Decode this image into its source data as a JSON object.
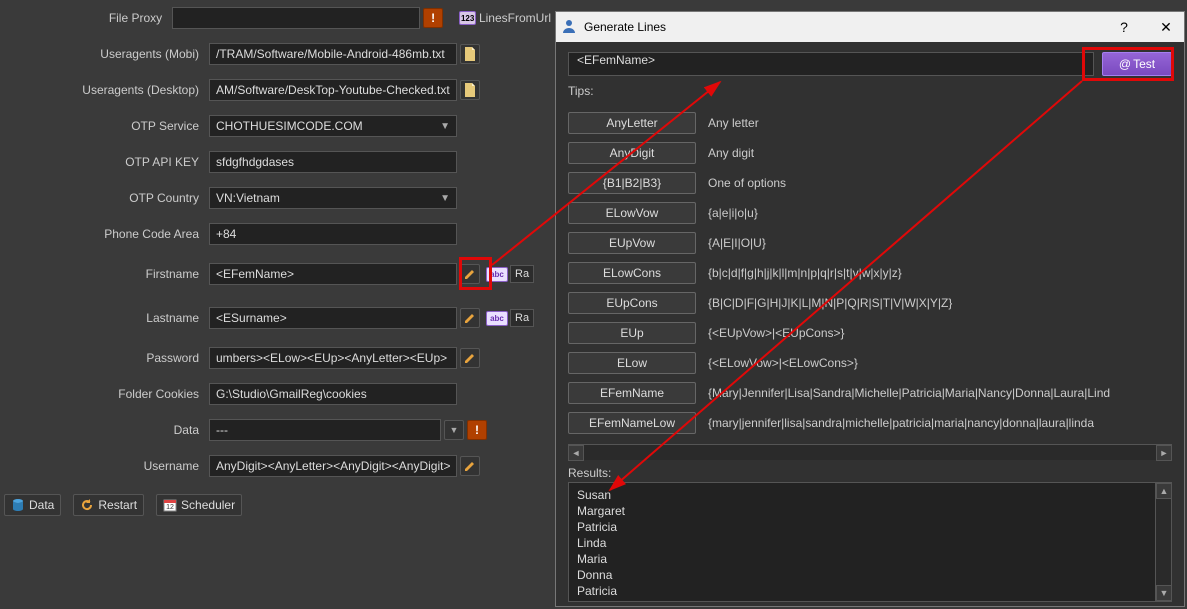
{
  "left_form": {
    "file_proxy_label": "File Proxy",
    "file_proxy_value": "",
    "lines_from_url_label": "LinesFromUrl",
    "ua_mobi_label": "Useragents (Mobi)",
    "ua_mobi_value": "/TRAM/Software/Mobile-Android-486mb.txt",
    "ua_desk_label": "Useragents (Desktop)",
    "ua_desk_value": "AM/Software/DeskTop-Youtube-Checked.txt",
    "otp_service_label": "OTP Service",
    "otp_service_value": "CHOTHUESIMCODE.COM",
    "otp_key_label": "OTP API KEY",
    "otp_key_value": "sfdgfhdgdases",
    "otp_country_label": "OTP Country",
    "otp_country_value": "VN:Vietnam",
    "phone_code_label": "Phone Code Area",
    "phone_code_value": "+84",
    "firstname_label": "Firstname",
    "firstname_value": "<EFemName>",
    "lastname_label": "Lastname",
    "lastname_value": "<ESurname>",
    "password_label": "Password",
    "password_value": "umbers><ELow><EUp><AnyLetter><EUp>",
    "cookies_label": "Folder Cookies",
    "cookies_value": "G:\\Studio\\GmailReg\\cookies",
    "data_label": "Data",
    "data_value": "---",
    "username_label": "Username",
    "username_value": "AnyDigit><AnyLetter><AnyDigit><AnyDigit>",
    "badge_123": "123",
    "badge_abc": "abc",
    "ra": "Ra"
  },
  "bottom_bar": {
    "data": "Data",
    "restart": "Restart",
    "scheduler": "Scheduler"
  },
  "dialog": {
    "title": "Generate Lines",
    "help": "?",
    "close": "✕",
    "input_value": "<EFemName>",
    "test_btn": "Test",
    "at": "@",
    "tips_label": "Tips:",
    "tips": [
      {
        "btn": "AnyLetter",
        "desc": "Any letter"
      },
      {
        "btn": "AnyDigit",
        "desc": "Any digit"
      },
      {
        "btn": "{B1|B2|B3}",
        "desc": "One of options"
      },
      {
        "btn": "ELowVow",
        "desc": "{a|e|i|o|u}"
      },
      {
        "btn": "EUpVow",
        "desc": "{A|E|I|O|U}"
      },
      {
        "btn": "ELowCons",
        "desc": "{b|c|d|f|g|h|j|k|l|m|n|p|q|r|s|t|v|w|x|y|z}"
      },
      {
        "btn": "EUpCons",
        "desc": "{B|C|D|F|G|H|J|K|L|M|N|P|Q|R|S|T|V|W|X|Y|Z}"
      },
      {
        "btn": "EUp",
        "desc": "{<EUpVow>|<EUpCons>}"
      },
      {
        "btn": "ELow",
        "desc": "{<ELowVow>|<ELowCons>}"
      },
      {
        "btn": "EFemName",
        "desc": "{Mary|Jennifer|Lisa|Sandra|Michelle|Patricia|Maria|Nancy|Donna|Laura|Lind"
      },
      {
        "btn": "EFemNameLow",
        "desc": "{mary|jennifer|lisa|sandra|michelle|patricia|maria|nancy|donna|laura|linda"
      }
    ],
    "results_label": "Results:",
    "results": [
      "Susan",
      "Margaret",
      "Patricia",
      "Linda",
      "Maria",
      "Donna",
      "Patricia"
    ]
  }
}
